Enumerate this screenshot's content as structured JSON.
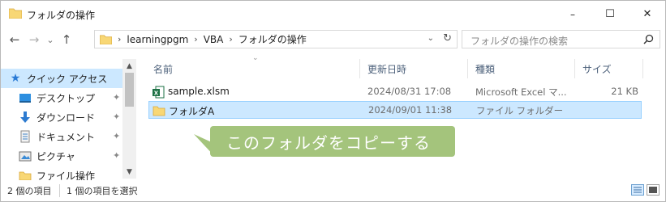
{
  "window": {
    "title": "フォルダの操作",
    "minimize_glyph": "–",
    "maximize_glyph": "☐",
    "close_glyph": "✕"
  },
  "nav": {
    "back_glyph": "←",
    "forward_glyph": "→",
    "recent_glyph": "⌄",
    "up_glyph": "↑"
  },
  "address": {
    "separator": "›",
    "crumbs": [
      "learningpgm",
      "VBA",
      "フォルダの操作"
    ],
    "dropdown_glyph": "⌄",
    "refresh_glyph": "↻"
  },
  "search": {
    "placeholder": "フォルダの操作の検索"
  },
  "sidebar": {
    "items": [
      {
        "label": "クイック アクセス",
        "icon": "star-icon",
        "selected": true
      },
      {
        "label": "デスクトップ",
        "icon": "desktop-icon",
        "pinned": true
      },
      {
        "label": "ダウンロード",
        "icon": "download-icon",
        "pinned": true
      },
      {
        "label": "ドキュメント",
        "icon": "document-icon",
        "pinned": true
      },
      {
        "label": "ピクチャ",
        "icon": "picture-icon",
        "pinned": true
      },
      {
        "label": "ファイル操作",
        "icon": "folder-icon",
        "pinned": false
      }
    ],
    "pin_glyph": "✦"
  },
  "columns": {
    "name": "名前",
    "date": "更新日時",
    "type": "種類",
    "size": "サイズ",
    "sort_glyph": "⌄"
  },
  "files": [
    {
      "name": "sample.xlsm",
      "date": "2024/08/31 17:08",
      "type": "Microsoft Excel マ...",
      "size": "21 KB",
      "icon": "excel-file-icon",
      "selected": false
    },
    {
      "name": "フォルダA",
      "date": "2024/09/01 11:38",
      "type": "ファイル フォルダー",
      "size": "",
      "icon": "folder-icon",
      "selected": true
    }
  ],
  "callout": {
    "text": "このフォルダをコピーする"
  },
  "status": {
    "item_count": "2 個の項目",
    "selected_count": "1 個の項目を選択"
  },
  "colors": {
    "callout": "#a4c47c",
    "selection": "#cce8ff",
    "folder": "#f8d775",
    "excel": "#1e7145"
  }
}
